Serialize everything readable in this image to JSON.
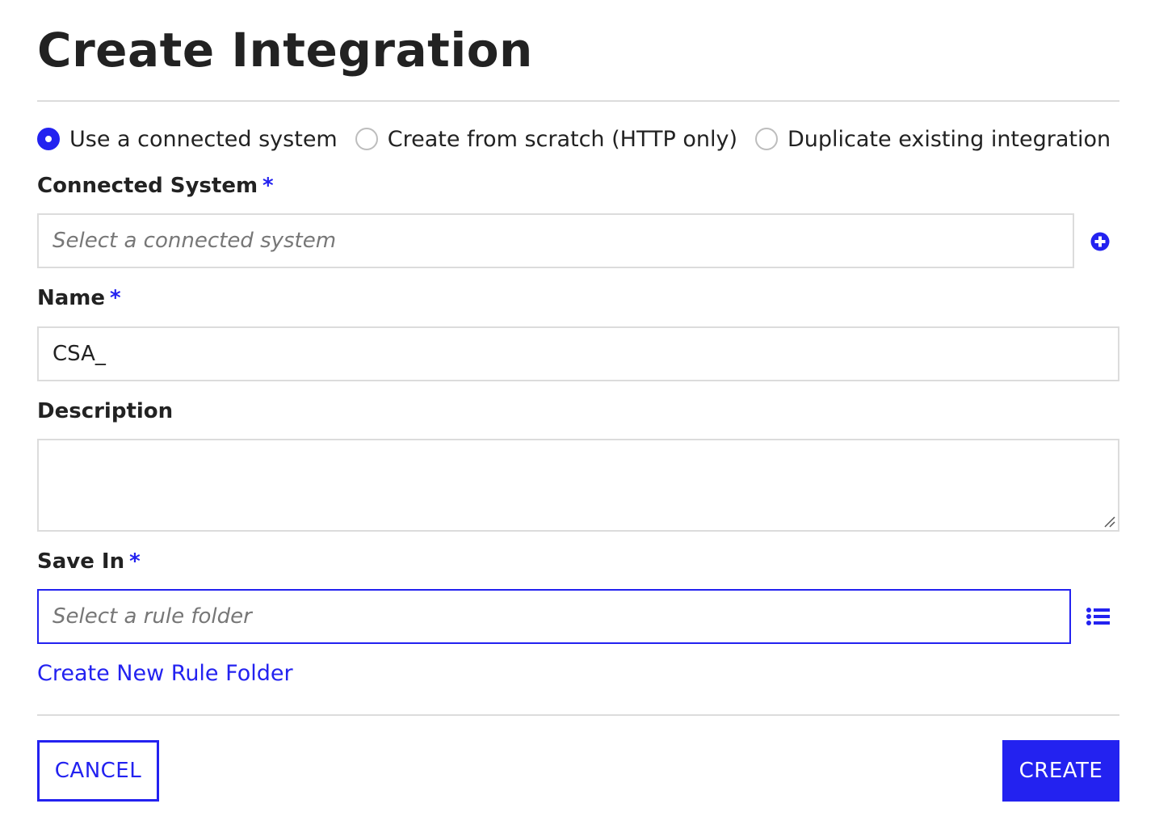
{
  "title": "Create Integration",
  "mode_options": [
    {
      "label": "Use a connected system",
      "selected": true
    },
    {
      "label": "Create from scratch (HTTP only)",
      "selected": false
    },
    {
      "label": "Duplicate existing integration",
      "selected": false
    }
  ],
  "fields": {
    "connected_system": {
      "label": "Connected System",
      "required_mark": "*",
      "placeholder": "Select a connected system",
      "value": ""
    },
    "name": {
      "label": "Name",
      "required_mark": "*",
      "value": "CSA_"
    },
    "description": {
      "label": "Description",
      "value": ""
    },
    "save_in": {
      "label": "Save In",
      "required_mark": "*",
      "placeholder": "Select a rule folder",
      "value": ""
    }
  },
  "icons": {
    "add_connected_system": "plus-circle-icon",
    "browse_folders": "list-icon",
    "resize": "resize-grip-icon"
  },
  "create_folder_link": "Create New Rule Folder",
  "buttons": {
    "cancel": "CANCEL",
    "create": "CREATE"
  },
  "colors": {
    "accent": "#2322f0",
    "border": "#dcdcdc",
    "text": "#222222"
  }
}
